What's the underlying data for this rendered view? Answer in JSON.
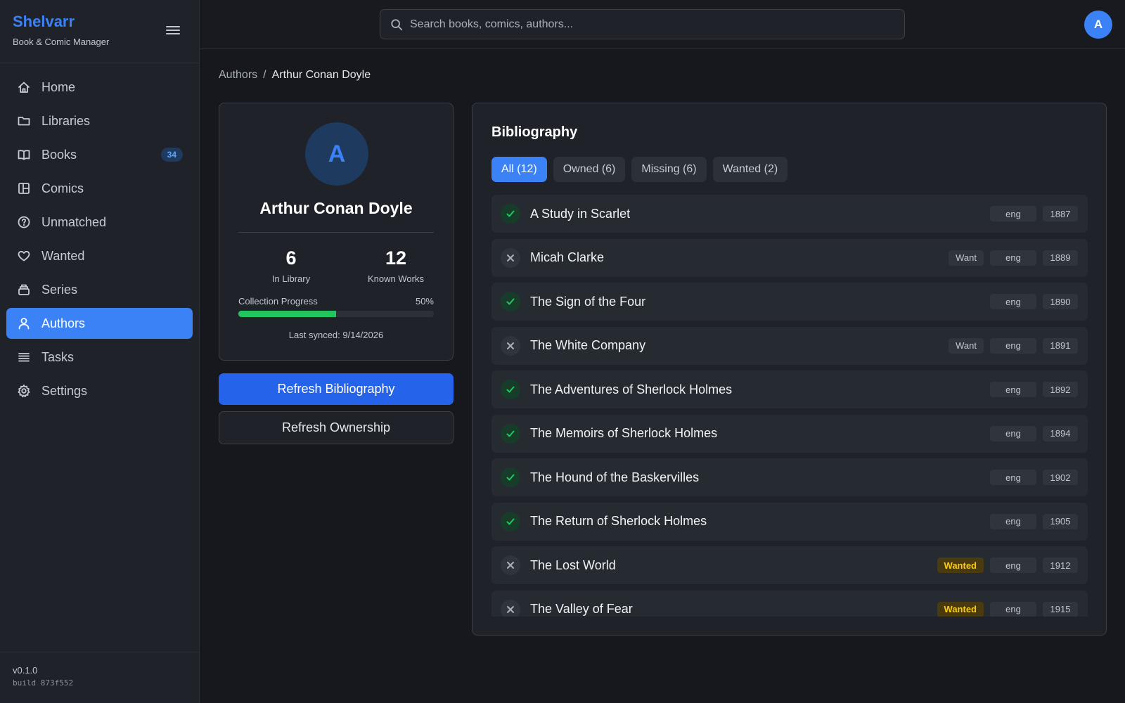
{
  "brand": {
    "name": "Shelvarr",
    "subtitle": "Book & Comic Manager"
  },
  "nav": {
    "items": [
      {
        "key": "home",
        "label": "Home",
        "icon": "home-icon"
      },
      {
        "key": "libraries",
        "label": "Libraries",
        "icon": "folder-icon"
      },
      {
        "key": "books",
        "label": "Books",
        "icon": "book-icon",
        "badge": "34"
      },
      {
        "key": "comics",
        "label": "Comics",
        "icon": "comic-icon"
      },
      {
        "key": "unmatched",
        "label": "Unmatched",
        "icon": "question-icon"
      },
      {
        "key": "wanted",
        "label": "Wanted",
        "icon": "heart-icon"
      },
      {
        "key": "series",
        "label": "Series",
        "icon": "stack-icon"
      },
      {
        "key": "authors",
        "label": "Authors",
        "icon": "user-icon",
        "active": true
      },
      {
        "key": "tasks",
        "label": "Tasks",
        "icon": "list-icon"
      },
      {
        "key": "settings",
        "label": "Settings",
        "icon": "gear-icon"
      }
    ]
  },
  "footer": {
    "version": "v0.1.0",
    "build": "build 873f552"
  },
  "search": {
    "placeholder": "Search books, comics, authors..."
  },
  "user": {
    "initial": "A"
  },
  "breadcrumb": {
    "parent": "Authors",
    "separator": "/",
    "current": "Arthur Conan Doyle"
  },
  "author": {
    "initial": "A",
    "name": "Arthur Conan Doyle",
    "in_library": "6",
    "in_library_label": "In Library",
    "known_works": "12",
    "known_works_label": "Known Works",
    "progress_label": "Collection Progress",
    "progress_text": "50%",
    "progress_value": 0.5,
    "last_synced": "Last synced: 9/14/2026"
  },
  "actions": {
    "refresh_bibliography": "Refresh Bibliography",
    "refresh_ownership": "Refresh Ownership"
  },
  "bibliography": {
    "title": "Bibliography",
    "tabs": [
      {
        "label": "All (12)",
        "active": true
      },
      {
        "label": "Owned (6)"
      },
      {
        "label": "Missing (6)"
      },
      {
        "label": "Wanted (2)"
      }
    ],
    "rows": [
      {
        "title": "A Study in Scarlet",
        "owned": true,
        "lang": "eng",
        "year": "1887",
        "flag": ""
      },
      {
        "title": "Micah Clarke",
        "owned": false,
        "lang": "eng",
        "year": "1889",
        "flag": "Want"
      },
      {
        "title": "The Sign of the Four",
        "owned": true,
        "lang": "eng",
        "year": "1890",
        "flag": ""
      },
      {
        "title": "The White Company",
        "owned": false,
        "lang": "eng",
        "year": "1891",
        "flag": "Want"
      },
      {
        "title": "The Adventures of Sherlock Holmes",
        "owned": true,
        "lang": "eng",
        "year": "1892",
        "flag": ""
      },
      {
        "title": "The Memoirs of Sherlock Holmes",
        "owned": true,
        "lang": "eng",
        "year": "1894",
        "flag": ""
      },
      {
        "title": "The Hound of the Baskervilles",
        "owned": true,
        "lang": "eng",
        "year": "1902",
        "flag": ""
      },
      {
        "title": "The Return of Sherlock Holmes",
        "owned": true,
        "lang": "eng",
        "year": "1905",
        "flag": ""
      },
      {
        "title": "The Lost World",
        "owned": false,
        "lang": "eng",
        "year": "1912",
        "flag": "Wanted"
      },
      {
        "title": "The Valley of Fear",
        "owned": false,
        "lang": "eng",
        "year": "1915",
        "flag": "Wanted"
      }
    ]
  },
  "colors": {
    "accent": "#3b82f6",
    "owned": "#22c55e",
    "wanted": "#facc15",
    "background": "#16181d"
  }
}
